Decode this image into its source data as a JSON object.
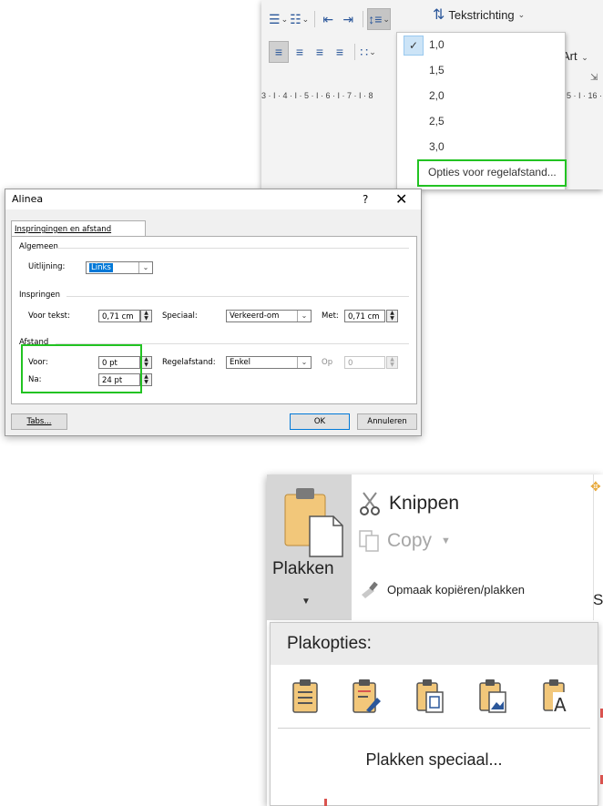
{
  "ribbon": {
    "tekstrichting": "Tekstrichting",
    "art_label": "Art",
    "launcher": "⇲",
    "ruler_text": "3 · I · 4 · I · 5 · I · 6 · I · 7 · I · 8",
    "ruler_right": "5 · I · 16 ·"
  },
  "line_spacing_menu": {
    "options": [
      "1,0",
      "1,5",
      "2,0",
      "2,5",
      "3,0"
    ],
    "checked": "1,0",
    "options_link": "Opties voor regelafstand..."
  },
  "dialog": {
    "title": "Alinea",
    "help": "?",
    "close": "✕",
    "tab": "Inspringingen en afstand",
    "algemeen": {
      "title": "Algemeen",
      "uitlijning_label": "Uitlijning:",
      "uitlijning_value": "Links"
    },
    "inspringen": {
      "title": "Inspringen",
      "voor_tekst_label": "Voor tekst:",
      "voor_tekst_value": "0,71 cm",
      "speciaal_label": "Speciaal:",
      "speciaal_value": "Verkeerd-om",
      "met_label": "Met:",
      "met_value": "0,71 cm"
    },
    "afstand": {
      "title": "Afstand",
      "voor_label": "Voor:",
      "voor_value": "0 pt",
      "na_label": "Na:",
      "na_value": "24 pt",
      "regelafstand_label": "Regelafstand:",
      "regelafstand_value": "Enkel",
      "op_label": "Op",
      "op_value": "0"
    },
    "buttons": {
      "tabs": "Tabs...",
      "ok": "OK",
      "annuleren": "Annuleren"
    }
  },
  "clipboard": {
    "plakken": "Plakken",
    "knippen": "Knippen",
    "copy": "Copy",
    "opmaak": "Opmaak kopiëren/plakken",
    "edge_letter": "S",
    "plakopties_header": "Plakopties:",
    "plakken_speciaal": "Plakken speciaal...",
    "paste_option_icons": [
      "paste-keep-source-icon",
      "paste-merge-formatting-icon",
      "paste-picture-frame-icon",
      "paste-picture-icon",
      "paste-text-only-icon"
    ]
  },
  "colors": {
    "highlight_green": "#22c322",
    "word_blue": "#2b579a",
    "selection_blue": "#0078d7",
    "clipboard_tan": "#f2c77a"
  }
}
